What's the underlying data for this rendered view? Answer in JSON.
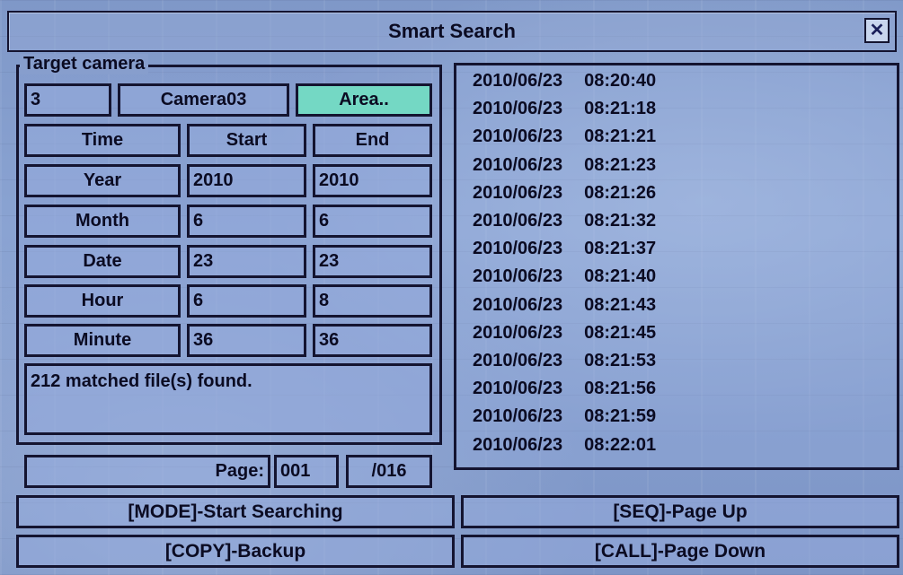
{
  "title": "Smart Search",
  "close_icon": "x-close-icon",
  "target_camera": {
    "legend": "Target camera",
    "number": "3",
    "name": "Camera03",
    "area_button": "Area.."
  },
  "time_table": {
    "header": {
      "label": "Time",
      "start": "Start",
      "end": "End"
    },
    "rows": [
      {
        "label": "Year",
        "start": "2010",
        "end": "2010"
      },
      {
        "label": "Month",
        "start": "6",
        "end": "6"
      },
      {
        "label": "Date",
        "start": "23",
        "end": "23"
      },
      {
        "label": "Hour",
        "start": "6",
        "end": "8"
      },
      {
        "label": "Minute",
        "start": "36",
        "end": "36"
      }
    ]
  },
  "status_message": "212 matched file(s) found.",
  "pagination": {
    "label": "Page:",
    "current": "001",
    "total": "/016"
  },
  "results": [
    {
      "date": "2010/06/23",
      "time": "08:20:40"
    },
    {
      "date": "2010/06/23",
      "time": "08:21:18"
    },
    {
      "date": "2010/06/23",
      "time": "08:21:21"
    },
    {
      "date": "2010/06/23",
      "time": "08:21:23"
    },
    {
      "date": "2010/06/23",
      "time": "08:21:26"
    },
    {
      "date": "2010/06/23",
      "time": "08:21:32"
    },
    {
      "date": "2010/06/23",
      "time": "08:21:37"
    },
    {
      "date": "2010/06/23",
      "time": "08:21:40"
    },
    {
      "date": "2010/06/23",
      "time": "08:21:43"
    },
    {
      "date": "2010/06/23",
      "time": "08:21:45"
    },
    {
      "date": "2010/06/23",
      "time": "08:21:53"
    },
    {
      "date": "2010/06/23",
      "time": "08:21:56"
    },
    {
      "date": "2010/06/23",
      "time": "08:21:59"
    },
    {
      "date": "2010/06/23",
      "time": "08:22:01"
    }
  ],
  "actions": {
    "mode": "[MODE]-Start Searching",
    "seq": "[SEQ]-Page Up",
    "copy": "[COPY]-Backup",
    "call": "[CALL]-Page Down"
  },
  "colors": {
    "accent": "#74d8c4",
    "border": "#141430",
    "background": "#8aa3d2"
  }
}
